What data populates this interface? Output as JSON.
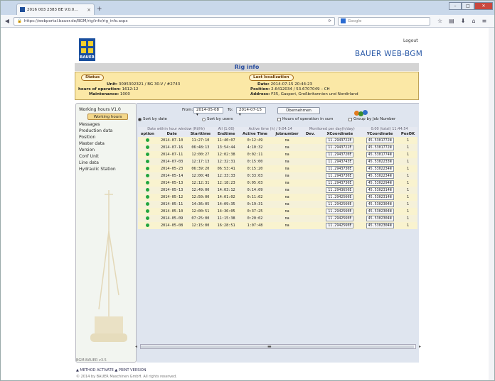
{
  "browser": {
    "tab_title": "2016 003 2383 BE V.0.0…",
    "new_tab": "+",
    "url": "https://webportal.bauer.de/BGM/rig/info/rig_info.aspx",
    "search_placeholder": "Google",
    "controls": {
      "min": "–",
      "max": "□",
      "close": "✕"
    }
  },
  "header": {
    "logout": "Logout",
    "logo_text": "BAUER",
    "brand": "BAUER WEB-BGM",
    "page_title": "Rig info"
  },
  "status": {
    "status_label": "Status",
    "unit_label": "Unit:",
    "unit_value": "3095302321 / BG 30-V / #2743",
    "hours_label": "hours of operation:",
    "hours_value": "1612:12",
    "maint_label": "Maintenance:",
    "maint_value": "1000",
    "loc_label": "Last localization",
    "date_label": "Date:",
    "date_value": "2014-07-15 20:44:23",
    "pos_label": "Position:",
    "pos_value": "2.6412034 / 53.6707049 – CH",
    "addr_label": "Address:",
    "addr_value": "F35, Gasperi, Großbritannien und Nordirland"
  },
  "sidebar": {
    "title": "Working hours V1.0",
    "active_button": "Working hours",
    "items": [
      "Messages",
      "Production data",
      "Position",
      "Master data",
      "Version",
      "Conf Unit",
      "Line data",
      "Hydraulic Station"
    ]
  },
  "filters": {
    "from_label": "From:",
    "from_value": "2014-05-08",
    "to_label": "To:",
    "to_value": "2014-07-15",
    "submit_label": "Übernehmen",
    "sort_date": "Sort by date",
    "sort_user": "Sort by users",
    "hours_in_sum": "Hours of operation in sum",
    "group_by_job": "Group by Job Number"
  },
  "table": {
    "group_headers": [
      "Date within hour window (Rt/Hr)",
      "All (1:00)",
      "Active time (h) / 9:04:14",
      "Monitored per day(h/day)",
      "0:00 (total) 11:44:54"
    ],
    "columns": [
      "option",
      "Date",
      "Starttime",
      "Endtime",
      "Active Time",
      "Jobnumber",
      "Dev.",
      "XCoordinate",
      "YCoordinate",
      "PosOK"
    ],
    "rows": [
      [
        "2014-07-10",
        "11:27:10",
        "11:40:07",
        "0:12:49",
        "na",
        "",
        "11.2943722E",
        "45.5301772N",
        "1"
      ],
      [
        "2014-07-16",
        "06:48:13",
        "13:54:44",
        "4:10:32",
        "na",
        "",
        "11.2943722E",
        "45.5301772N",
        "1"
      ],
      [
        "2014-07-11",
        "12:00:27",
        "12:02:38",
        "0:02:11",
        "na",
        "",
        "11.2943720E",
        "45.5301774N",
        "1"
      ],
      [
        "2014-07-03",
        "12:17:13",
        "12:32:31",
        "0:15:00",
        "na",
        "",
        "11.2943743E",
        "45.5302233N",
        "1"
      ],
      [
        "2014-05-23",
        "06:39:20",
        "06:53:41",
        "0:15:20",
        "na",
        "",
        "11.2943730E",
        "45.5302234N",
        "1"
      ],
      [
        "2014-05-14",
        "12:00:48",
        "12:33:33",
        "0:33:03",
        "na",
        "",
        "11.2943730E",
        "45.5302234N",
        "1"
      ],
      [
        "2014-05-13",
        "12:12:31",
        "12:18:23",
        "0:05:03",
        "na",
        "",
        "11.2943730E",
        "45.5302294N",
        "1"
      ],
      [
        "2014-05-13",
        "12:49:00",
        "14:03:12",
        "0:14:09",
        "na",
        "",
        "11.2943650E",
        "45.5302314N",
        "1"
      ],
      [
        "2014-05-12",
        "12:50:00",
        "14:01:02",
        "0:11:02",
        "na",
        "",
        "11.2942560E",
        "45.5302314N",
        "1"
      ],
      [
        "2014-05-11",
        "14:36:05",
        "14:09:35",
        "0:19:31",
        "na",
        "",
        "11.2942560E",
        "45.5302304N",
        "1"
      ],
      [
        "2014-05-10",
        "12:00:51",
        "14:36:05",
        "0:37:25",
        "na",
        "",
        "11.2942560E",
        "45.5302304N",
        "1"
      ],
      [
        "2014-05-09",
        "07:25:00",
        "11:15:38",
        "0:20:02",
        "na",
        "",
        "11.2942560E",
        "45.5302304N",
        "1"
      ],
      [
        "2014-05-08",
        "12:15:00",
        "16:28:51",
        "1:07:48",
        "na",
        "",
        "11.2942560E",
        "45.5302304N",
        "1"
      ]
    ]
  },
  "footer": {
    "version": "BGM-BAUER v3.5",
    "links": "▲ METHOD ACTIVATE  ▲  PRINT VERSION",
    "copyright": "© 2014 by BAUER Maschinen GmbH. All rights reserved."
  },
  "colors": {
    "brand_blue": "#1a4f9e",
    "logo_yellow": "#f4d02c",
    "status_yellow": "#fbe8a6",
    "green_dot": "#21a53f"
  }
}
